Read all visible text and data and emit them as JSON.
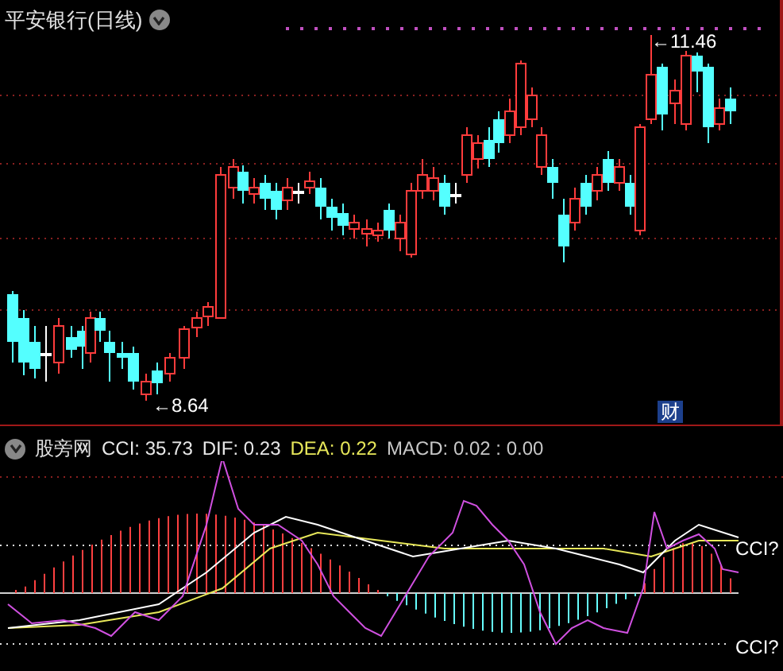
{
  "chart_title": "平安银行(日线)",
  "price_chart": {
    "high_label": "←11.46",
    "low_label": "←8.64",
    "badge": "财"
  },
  "indicator": {
    "name": "股旁网",
    "readouts": [
      {
        "label": "CCI:",
        "value": "35.73",
        "color": "#e8e8e8"
      },
      {
        "label": "DIF:",
        "value": "0.23",
        "color": "#e8e8e8"
      },
      {
        "label": "DEA:",
        "value": "0.22",
        "color": "#e8e85a"
      },
      {
        "label": "MACD:",
        "value": "0.02 : 0.00",
        "color": "#c8c8c8"
      }
    ],
    "line_labels": [
      "CCI?",
      "CCI?"
    ]
  }
}
